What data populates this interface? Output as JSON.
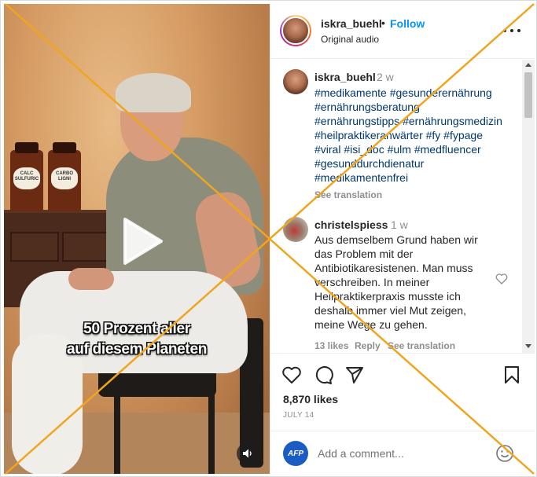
{
  "post": {
    "username": "iskra_buehl",
    "separator": "•",
    "follow_label": "Follow",
    "audio_label": "Original audio",
    "more_label": "More options"
  },
  "video": {
    "caption_line1": "50 Prozent aller",
    "caption_line2": "auf diesem Planeten",
    "jar1_label": "CALC SULFURIC",
    "jar2_label": "CARBO LIGNI"
  },
  "comments": [
    {
      "username": "iskra_buehl",
      "time": "2 w",
      "hashtags": [
        "#medikamente #gesunderernährung",
        "#ernährungsberatung",
        "#ernährungstipps #ernährungsmedizin",
        "#heilpraktikeranwärter #fy #fypage",
        "#viral #isi_doc #ulm #medfluencer",
        "#gesunddurchdienatur",
        "#medikamentenfrei"
      ],
      "see_translation": "See translation"
    },
    {
      "username": "christelspiess",
      "time": "1 w",
      "text": "Aus demselbem Grund haben wir das Problem mit der Antibiotikaresistenen. Man muss verschreiben. In meiner Heilpraktikerpraxis musste ich deshalb immer viel Mut zeigen, meine Wege zu gehen.",
      "likes": "13 likes",
      "reply": "Reply",
      "see_translation": "See translation"
    }
  ],
  "actions": {
    "likes": "8,870 likes",
    "date": "JULY 14"
  },
  "add_comment": {
    "avatar_text": "AFP",
    "placeholder": "Add a comment..."
  },
  "colors": {
    "link_blue": "#0095f6",
    "hashtag": "#00376b",
    "muted": "#8e8e8e",
    "cross": "#f0a51e"
  }
}
